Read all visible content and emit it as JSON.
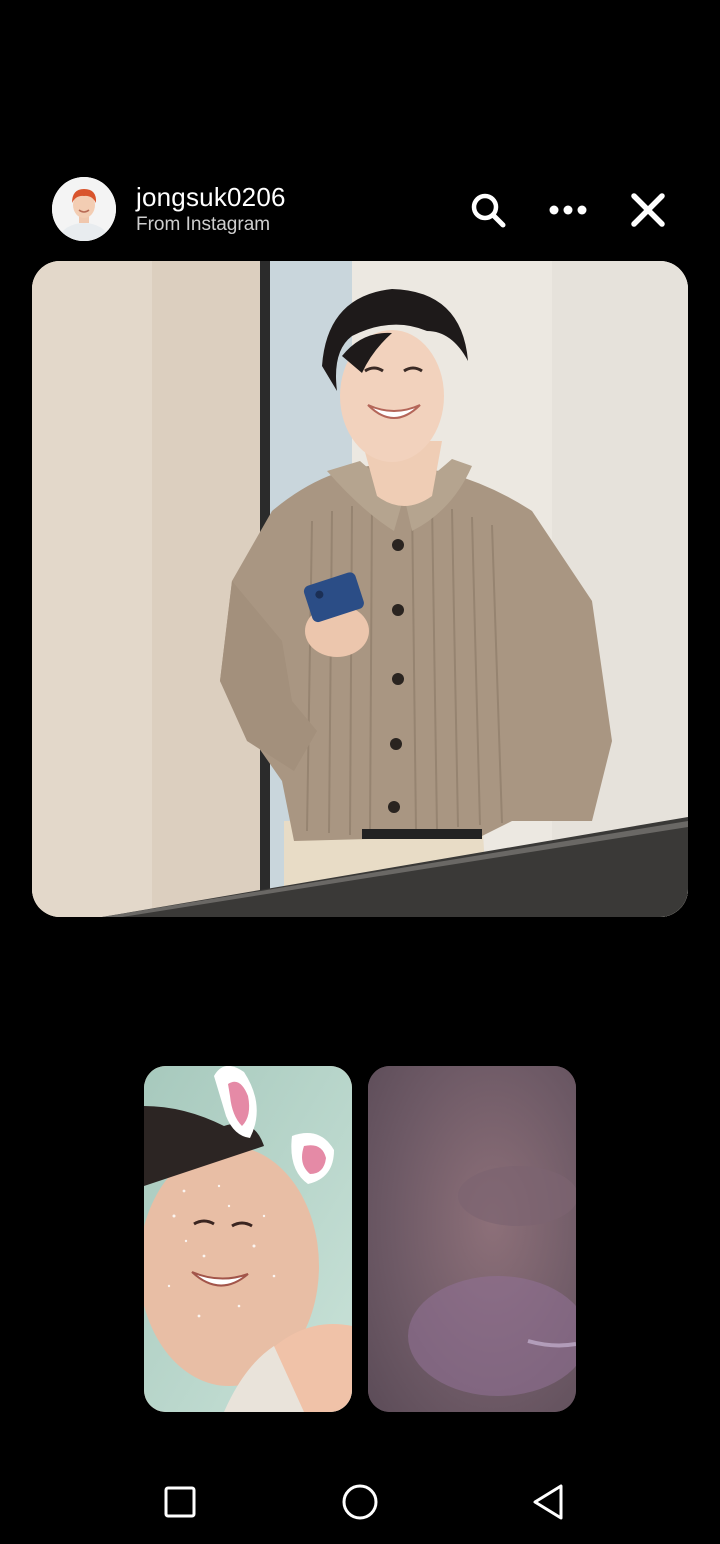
{
  "header": {
    "username": "jongsuk0206",
    "source": "From Instagram",
    "icons": {
      "search": "search-icon",
      "more": "more-icon",
      "close": "close-icon"
    }
  },
  "main_photo": {
    "description_icon": "photo"
  },
  "video_tiles": [
    {
      "name": "self-video-tile"
    },
    {
      "name": "remote-video-tile"
    }
  ],
  "navbar": {
    "icons": [
      "recent-apps-icon",
      "home-icon",
      "back-icon"
    ]
  },
  "colors": {
    "background": "#000000",
    "text_primary": "#ffffff",
    "text_secondary": "#cfcfcf"
  }
}
